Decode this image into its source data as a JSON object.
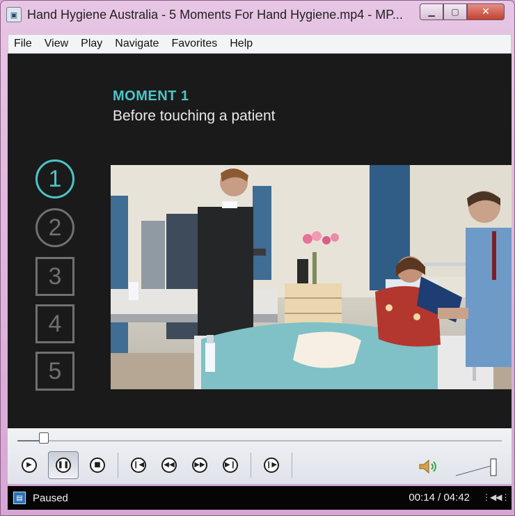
{
  "window": {
    "title": "Hand Hygiene Australia - 5 Moments For Hand Hygiene.mp4 - MP...",
    "app_icon": "media-player-icon",
    "minimize_icon": "minimize-icon",
    "maximize_icon": "maximize-icon",
    "close_icon": "close-icon"
  },
  "menu": {
    "items": [
      "File",
      "View",
      "Play",
      "Navigate",
      "Favorites",
      "Help"
    ]
  },
  "video": {
    "heading": "MOMENT 1",
    "subheading": "Before touching a patient",
    "steps": [
      "1",
      "2",
      "3",
      "4",
      "5"
    ],
    "active_step": "1",
    "accent_color": "#4cc4c8"
  },
  "playback": {
    "progress_fraction": 0.055,
    "buttons": [
      {
        "name": "play-button",
        "icon": "play-icon"
      },
      {
        "name": "pause-button",
        "icon": "pause-icon"
      },
      {
        "name": "stop-button",
        "icon": "stop-icon"
      },
      {
        "name": "previous-button",
        "icon": "skip-back-icon"
      },
      {
        "name": "rewind-button",
        "icon": "rewind-icon"
      },
      {
        "name": "fast-forward-button",
        "icon": "fast-forward-icon"
      },
      {
        "name": "next-button",
        "icon": "skip-forward-icon"
      },
      {
        "name": "step-frame-button",
        "icon": "frame-step-icon"
      }
    ],
    "volume_icon": "speaker-icon"
  },
  "status": {
    "state": "Paused",
    "time": "00:14 / 04:42",
    "switch_icon": "switch-to-library-icon"
  }
}
